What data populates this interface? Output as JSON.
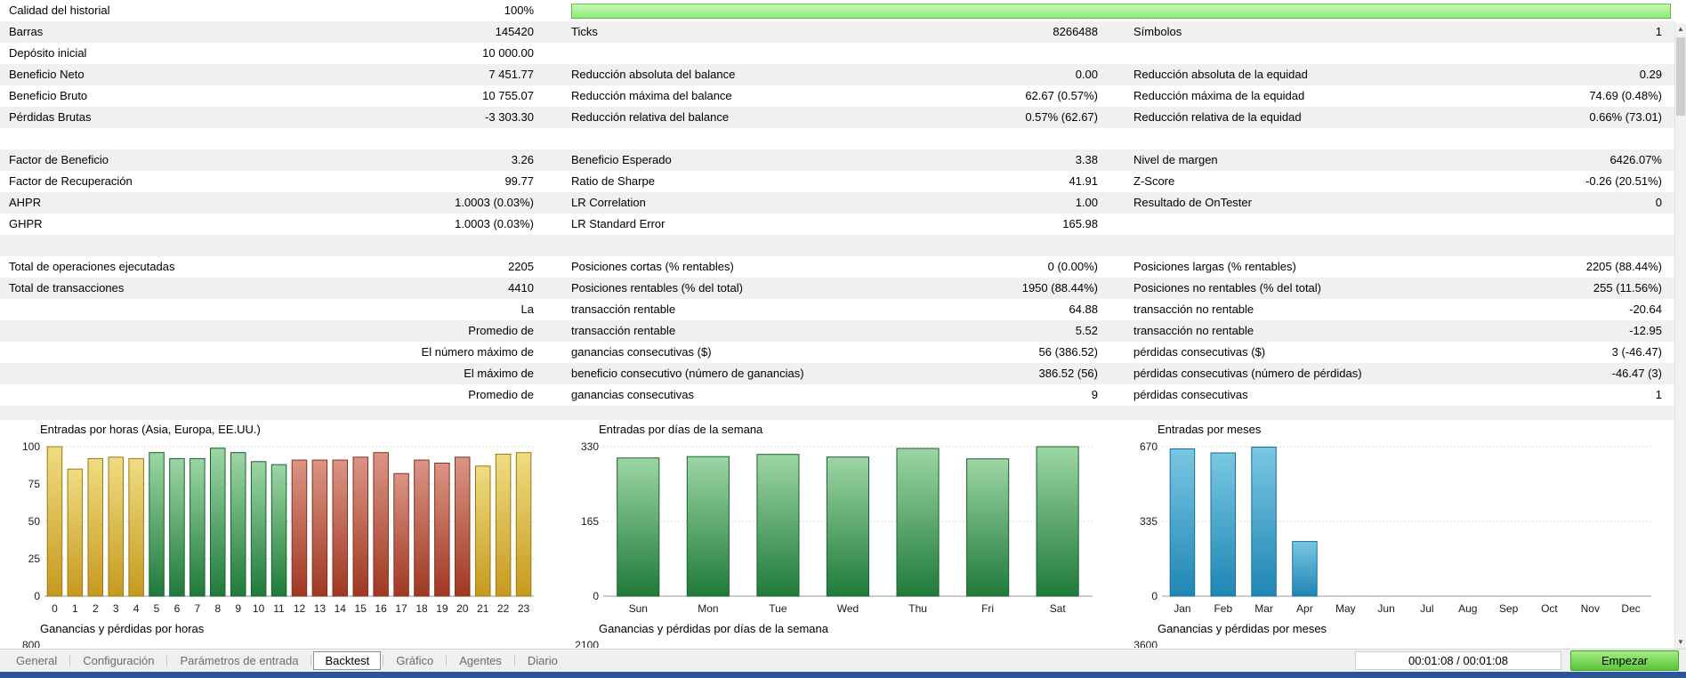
{
  "quality": {
    "label": "Calidad del historial",
    "value": "100%"
  },
  "table": {
    "rows": [
      {
        "c": [
          [
            "Barras",
            "145420"
          ],
          [
            "Ticks",
            "8266488"
          ],
          [
            "Símbolos",
            "1"
          ]
        ]
      },
      {
        "c": [
          [
            "Depósito inicial",
            "10 000.00"
          ],
          [
            "",
            ""
          ],
          [
            "",
            ""
          ]
        ]
      },
      {
        "c": [
          [
            "Beneficio Neto",
            "7 451.77"
          ],
          [
            "Reducción absoluta del balance",
            "0.00"
          ],
          [
            "Reducción absoluta de la equidad",
            "0.29"
          ]
        ]
      },
      {
        "c": [
          [
            "Beneficio Bruto",
            "10 755.07"
          ],
          [
            "Reducción máxima del balance",
            "62.67 (0.57%)"
          ],
          [
            "Reducción máxima de la equidad",
            "74.69 (0.48%)"
          ]
        ]
      },
      {
        "c": [
          [
            "Pérdidas Brutas",
            "-3 303.30"
          ],
          [
            "Reducción relativa del balance",
            "0.57% (62.67)"
          ],
          [
            "Reducción relativa de la equidad",
            "0.66% (73.01)"
          ]
        ]
      },
      {
        "sep": true
      },
      {
        "c": [
          [
            "Factor de Beneficio",
            "3.26"
          ],
          [
            "Beneficio Esperado",
            "3.38"
          ],
          [
            "Nivel de margen",
            "6426.07%"
          ]
        ]
      },
      {
        "c": [
          [
            "Factor de Recuperación",
            "99.77"
          ],
          [
            "Ratio de Sharpe",
            "41.91"
          ],
          [
            "Z-Score",
            "-0.26 (20.51%)"
          ]
        ]
      },
      {
        "c": [
          [
            "AHPR",
            "1.0003 (0.03%)"
          ],
          [
            "LR Correlation",
            "1.00"
          ],
          [
            "Resultado de OnTester",
            "0"
          ]
        ]
      },
      {
        "c": [
          [
            "GHPR",
            "1.0003 (0.03%)"
          ],
          [
            "LR Standard Error",
            "165.98"
          ],
          [
            "",
            ""
          ]
        ]
      },
      {
        "sep": true
      },
      {
        "c": [
          [
            "Total de operaciones ejecutadas",
            "2205"
          ],
          [
            "Posiciones cortas (% rentables)",
            "0 (0.00%)"
          ],
          [
            "Posiciones largas (% rentables)",
            "2205 (88.44%)"
          ]
        ]
      },
      {
        "c": [
          [
            "Total de transacciones",
            "4410"
          ],
          [
            "Posiciones rentables (% del total)",
            "1950 (88.44%)"
          ],
          [
            "Posiciones no rentables (% del total)",
            "255 (11.56%)"
          ]
        ]
      },
      {
        "c": [
          [
            "",
            "La"
          ],
          [
            "transacción rentable",
            "64.88"
          ],
          [
            "transacción no rentable",
            "-20.64"
          ]
        ]
      },
      {
        "c": [
          [
            "",
            "Promedio de"
          ],
          [
            "transacción rentable",
            "5.52"
          ],
          [
            "transacción no rentable",
            "-12.95"
          ]
        ]
      },
      {
        "c": [
          [
            "",
            "El número máximo de"
          ],
          [
            "ganancias consecutivas ($)",
            "56 (386.52)"
          ],
          [
            "pérdidas consecutivas ($)",
            "3 (-46.47)"
          ]
        ]
      },
      {
        "c": [
          [
            "",
            "El máximo de"
          ],
          [
            "beneficio consecutivo (número de ganancias)",
            "386.52 (56)"
          ],
          [
            "pérdidas consecutivas (número de pérdidas)",
            "-46.47 (3)"
          ]
        ]
      },
      {
        "c": [
          [
            "",
            "Promedio de"
          ],
          [
            "ganancias consecutivas",
            "9"
          ],
          [
            "pérdidas consecutivas",
            "1"
          ]
        ]
      }
    ]
  },
  "chart_data": [
    {
      "type": "bar",
      "title": "Entradas por horas (Asia, Europa, EE.UU.)",
      "categories": [
        "0",
        "1",
        "2",
        "3",
        "4",
        "5",
        "6",
        "7",
        "8",
        "9",
        "10",
        "11",
        "12",
        "13",
        "14",
        "15",
        "16",
        "17",
        "18",
        "19",
        "20",
        "21",
        "22",
        "23"
      ],
      "values": [
        100,
        85,
        92,
        93,
        92,
        96,
        92,
        92,
        99,
        96,
        90,
        88,
        91,
        91,
        91,
        93,
        96,
        82,
        91,
        89,
        93,
        87,
        95,
        96
      ],
      "bar_colors": [
        "gold",
        "gold",
        "gold",
        "gold",
        "gold",
        "green",
        "green",
        "green",
        "green",
        "green",
        "green",
        "green",
        "red",
        "red",
        "red",
        "red",
        "red",
        "red",
        "red",
        "red",
        "red",
        "gold",
        "gold",
        "gold"
      ],
      "ylim": [
        0,
        100
      ],
      "yticks": [
        0,
        25,
        50,
        75,
        100
      ],
      "bar_frac": 0.72,
      "xlabel": "",
      "ylabel": ""
    },
    {
      "type": "bar",
      "title": "Entradas por días de la semana",
      "categories": [
        "Sun",
        "Mon",
        "Tue",
        "Wed",
        "Thu",
        "Fri",
        "Sat"
      ],
      "values": [
        305,
        308,
        313,
        307,
        326,
        303,
        330
      ],
      "bar_colors": [
        "green",
        "green",
        "green",
        "green",
        "green",
        "green",
        "green"
      ],
      "ylim": [
        0,
        330
      ],
      "yticks": [
        0,
        165,
        330
      ],
      "bar_frac": 0.6,
      "xlabel": "",
      "ylabel": ""
    },
    {
      "type": "bar",
      "title": "Entradas por meses",
      "categories": [
        "Jan",
        "Feb",
        "Mar",
        "Apr",
        "May",
        "Jun",
        "Jul",
        "Aug",
        "Sep",
        "Oct",
        "Nov",
        "Dec"
      ],
      "values": [
        660,
        642,
        668,
        245,
        0,
        0,
        0,
        0,
        0,
        0,
        0,
        0
      ],
      "bar_colors": [
        "blue",
        "blue",
        "blue",
        "blue",
        "blue",
        "blue",
        "blue",
        "blue",
        "blue",
        "blue",
        "blue",
        "blue"
      ],
      "ylim": [
        0,
        670
      ],
      "yticks": [
        0,
        335,
        670
      ],
      "bar_frac": 0.6,
      "xlabel": "",
      "ylabel": ""
    }
  ],
  "palette": {
    "gold": {
      "top": "#f0dc82",
      "bottom": "#c69a1e",
      "border": "#9a7a12"
    },
    "green": {
      "top": "#9cd6a4",
      "bottom": "#1f7a3a",
      "border": "#166030"
    },
    "red": {
      "top": "#dc9485",
      "bottom": "#a03822",
      "border": "#83301c"
    },
    "blue": {
      "top": "#79c7e3",
      "bottom": "#1f86b4",
      "border": "#1a6f96"
    }
  },
  "partial_charts": [
    {
      "title": "Ganancias y pérdidas por horas",
      "tick": "800"
    },
    {
      "title": "Ganancias y pérdidas por días de la semana",
      "tick": "2100"
    },
    {
      "title": "Ganancias y pérdidas por meses",
      "tick": "3600"
    }
  ],
  "tabs": {
    "items": [
      "General",
      "Configuración",
      "Parámetros de entrada",
      "Backtest",
      "Gráfico",
      "Agentes",
      "Diario"
    ],
    "active": "Backtest"
  },
  "statusbar": {
    "time": "00:01:08 / 00:01:08",
    "start_label": "Empezar"
  },
  "colors": {
    "quality_bar": "#8ce979",
    "start_button": "#58c63a",
    "row_stripe": "#f0f0f0",
    "bottom_strip": "#2a5699"
  }
}
